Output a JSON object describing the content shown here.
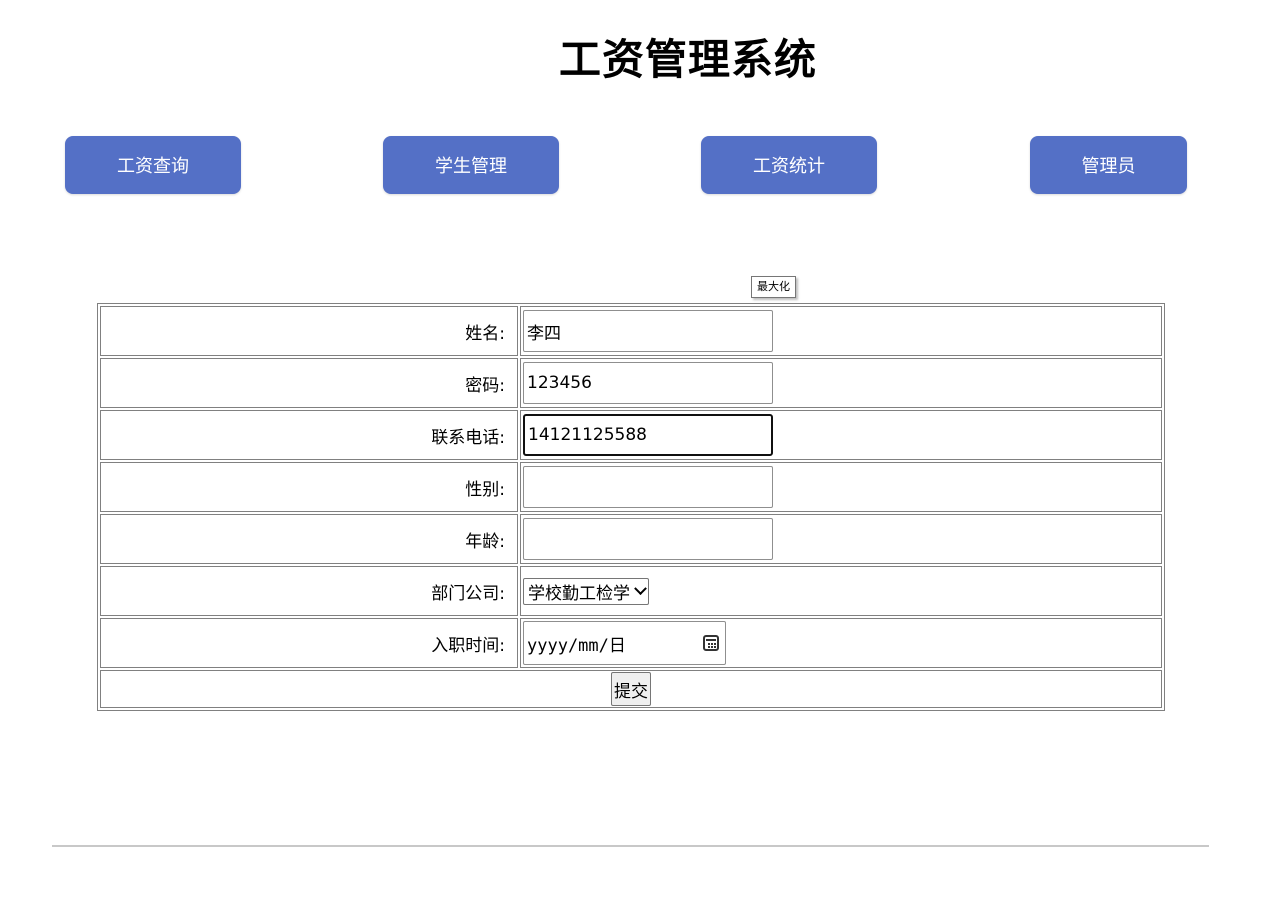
{
  "header": {
    "title": "工资管理系统"
  },
  "nav": {
    "items": [
      {
        "label": "工资查询"
      },
      {
        "label": "学生管理"
      },
      {
        "label": "工资统计"
      },
      {
        "label": "管理员"
      }
    ]
  },
  "tooltip": {
    "text": "最大化"
  },
  "form": {
    "name": {
      "label": "姓名:",
      "value": "李四"
    },
    "password": {
      "label": "密码:",
      "value": "123456"
    },
    "phone": {
      "label": "联系电话:",
      "value": "14121125588"
    },
    "gender": {
      "label": "性别:",
      "value": ""
    },
    "age": {
      "label": "年龄:",
      "value": ""
    },
    "department": {
      "label": "部门公司:",
      "selected": "学校勤工检学"
    },
    "hire_date": {
      "label": "入职时间:",
      "placeholder": "yyyy/mm/日"
    },
    "submit_label": "提交"
  },
  "colors": {
    "nav_button": "#5470c6",
    "background": "#ffffff"
  },
  "icons": {
    "calendar": "calendar-icon",
    "select_arrow": "chevron-down-icon"
  }
}
